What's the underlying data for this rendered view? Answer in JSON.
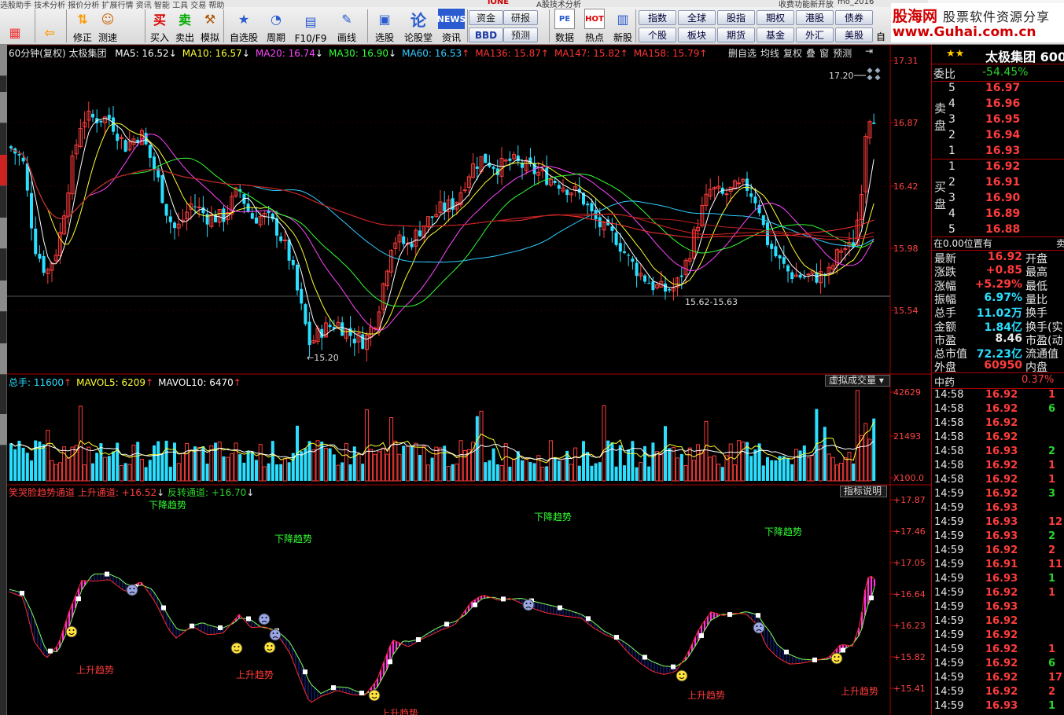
{
  "toolbar": {
    "menu_hint": "选股助手   技术分析   报价分析   扩展行情   资讯   智能   工具   交易   帮助",
    "buttons": [
      {
        "label": "",
        "icon": "grid-icon"
      },
      {
        "label": "",
        "icon": "back-arrow-icon"
      },
      {
        "label": "修正",
        "icon": "up-down-icon"
      },
      {
        "label": "测速",
        "icon": "smile-icon"
      },
      {
        "label": "买入",
        "icon": "buy-icon",
        "glyph": "买"
      },
      {
        "label": "卖出",
        "icon": "sell-icon",
        "glyph": "卖"
      },
      {
        "label": "模拟",
        "icon": "gavel-icon"
      },
      {
        "label": "自选股",
        "icon": "star-icon"
      },
      {
        "label": "周期",
        "icon": "clock-icon"
      },
      {
        "label": "F10/F9",
        "icon": "list-icon"
      },
      {
        "label": "画线",
        "icon": "pencil-icon"
      },
      {
        "label": "选股",
        "icon": "monitor-icon"
      },
      {
        "label": "论股堂",
        "icon": "lun-icon",
        "glyph": "论"
      },
      {
        "label": "资讯",
        "icon": "news-icon",
        "glyph": "NEWS"
      },
      {
        "label": "数据",
        "icon": "pe-icon",
        "glyph": "PE"
      },
      {
        "label": "热点",
        "icon": "hot-icon",
        "glyph": "HOT"
      },
      {
        "label": "新股",
        "icon": "new-stock-icon"
      }
    ],
    "small_buttons": [
      "资金",
      "研报",
      "BBD",
      "预测"
    ],
    "market_buttons": [
      "指数",
      "全球",
      "股指",
      "期权",
      "港股",
      "债券",
      "个股",
      "板块",
      "期货",
      "基金",
      "外汇",
      "美股"
    ],
    "extra": "自",
    "top_text": [
      "iONE",
      "A股技术分析",
      "收费功能新开放",
      "mo_2016"
    ]
  },
  "logo": {
    "line1": "股海网",
    "line2": "股票软件资源分享",
    "line3": "www.Guhai.com.cn"
  },
  "main_chart": {
    "title": "60分钟(复权)  太极集团",
    "ma": [
      {
        "label": "MA5: 16.52",
        "arrow": "↓",
        "color": "#ffffff"
      },
      {
        "label": "MA10: 16.57",
        "arrow": "↓",
        "color": "#ffff33"
      },
      {
        "label": "MA20: 16.74",
        "arrow": "↓",
        "color": "#ff44ff"
      },
      {
        "label": "MA30: 16.90",
        "arrow": "↓",
        "color": "#33ff33"
      },
      {
        "label": "MA60: 16.53",
        "arrow": "↑",
        "color": "#33ccff"
      },
      {
        "label": "MA136: 15.87",
        "arrow": "↑",
        "color": "#ff3333"
      },
      {
        "label": "MA147: 15.82",
        "arrow": "↑",
        "color": "#ff3333"
      },
      {
        "label": "MA158: 15.79",
        "arrow": "↑",
        "color": "#ff3333"
      }
    ],
    "controls": [
      "删自选",
      "均线",
      "复权",
      "叠",
      "窗",
      "预测"
    ],
    "y_axis": [
      "17.31",
      "16.87",
      "16.42",
      "15.98",
      "15.54"
    ],
    "annotations": {
      "high": "17.20",
      "low": "15.20",
      "range": "15.62-15.63"
    }
  },
  "volume": {
    "labels": [
      {
        "text": "总手: 11600",
        "color": "#2adfff"
      },
      {
        "text": "MAVOL5: 6209",
        "color": "#ffff33"
      },
      {
        "text": "MAVOL10: 6470",
        "color": "#ffffff"
      }
    ],
    "dropdown": "虚拟成交量",
    "y_axis": [
      "42629",
      "21493",
      "X100.0"
    ]
  },
  "indicator": {
    "name": "笑哭脸趋势通道",
    "up_channel": "上升通道: +16.52",
    "rev_channel": "反转通道: +16.70",
    "button": "指标说明",
    "y_axis": [
      "+17.87",
      "+17.46",
      "+17.05",
      "+16.64",
      "+16.23",
      "+15.82",
      "+15.41"
    ],
    "down_trend": [
      "下降趋势",
      "下降趋势",
      "下降趋势",
      "下降趋势"
    ],
    "up_trend": [
      "上升趋势",
      "上升趋势",
      "上升趋势",
      "上升趋势",
      "上升趋势"
    ]
  },
  "quote": {
    "stock_name": "太极集团 600",
    "weibi_label": "委比",
    "weibi": "-54.45%",
    "sell_label": "卖盘",
    "buy_label": "买盘",
    "sell": [
      {
        "n": "5",
        "p": "16.97"
      },
      {
        "n": "4",
        "p": "16.96"
      },
      {
        "n": "3",
        "p": "16.95"
      },
      {
        "n": "2",
        "p": "16.94"
      },
      {
        "n": "1",
        "p": "16.93"
      }
    ],
    "buy": [
      {
        "n": "1",
        "p": "16.92"
      },
      {
        "n": "2",
        "p": "16.91"
      },
      {
        "n": "3",
        "p": "16.90"
      },
      {
        "n": "4",
        "p": "16.89"
      },
      {
        "n": "5",
        "p": "16.88"
      }
    ],
    "position": "在0.00位置有",
    "position_right": "卖",
    "stats": [
      {
        "k": "最新",
        "v": "16.92",
        "c": "red",
        "k2": "开盘"
      },
      {
        "k": "涨跌",
        "v": "+0.85",
        "c": "red",
        "k2": "最高"
      },
      {
        "k": "涨幅",
        "v": "+5.29%",
        "c": "red",
        "k2": "最低"
      },
      {
        "k": "振幅",
        "v": "6.97%",
        "c": "cyan",
        "k2": "量比"
      },
      {
        "k": "总手",
        "v": "11.02万",
        "c": "cyan",
        "k2": "换手"
      },
      {
        "k": "金额",
        "v": "1.84亿",
        "c": "cyan",
        "k2": "换手(实"
      },
      {
        "k": "市盈",
        "v": "8.46",
        "c": "wht",
        "k2": "市盈(动"
      },
      {
        "k": "总市值",
        "v": "72.23亿",
        "c": "cyan",
        "k2": "流通值"
      },
      {
        "k": "外盘",
        "v": "60950",
        "c": "red",
        "k2": "内盘"
      }
    ],
    "sector": "中药",
    "sector_change": "0.37%",
    "ticks": [
      {
        "t": "14:58",
        "p": "16.92",
        "v": "1"
      },
      {
        "t": "14:58",
        "p": "16.92",
        "v": "6"
      },
      {
        "t": "14:58",
        "p": "16.92",
        "v": ""
      },
      {
        "t": "14:58",
        "p": "16.92",
        "v": ""
      },
      {
        "t": "14:58",
        "p": "16.93",
        "v": "2"
      },
      {
        "t": "14:58",
        "p": "16.92",
        "v": "1"
      },
      {
        "t": "14:58",
        "p": "16.92",
        "v": "1"
      },
      {
        "t": "14:59",
        "p": "16.92",
        "v": "3"
      },
      {
        "t": "14:59",
        "p": "16.93",
        "v": ""
      },
      {
        "t": "14:59",
        "p": "16.93",
        "v": "12"
      },
      {
        "t": "14:59",
        "p": "16.93",
        "v": "2"
      },
      {
        "t": "14:59",
        "p": "16.92",
        "v": "2"
      },
      {
        "t": "14:59",
        "p": "16.91",
        "v": "11"
      },
      {
        "t": "14:59",
        "p": "16.93",
        "v": "1"
      },
      {
        "t": "14:59",
        "p": "16.92",
        "v": "1"
      },
      {
        "t": "14:59",
        "p": "16.93",
        "v": ""
      },
      {
        "t": "14:59",
        "p": "16.92",
        "v": ""
      },
      {
        "t": "14:59",
        "p": "16.92",
        "v": ""
      },
      {
        "t": "14:59",
        "p": "16.92",
        "v": "1"
      },
      {
        "t": "14:59",
        "p": "16.92",
        "v": "6"
      },
      {
        "t": "14:59",
        "p": "16.92",
        "v": "17"
      },
      {
        "t": "14:59",
        "p": "16.92",
        "v": "2"
      },
      {
        "t": "14:59",
        "p": "16.93",
        "v": "1"
      }
    ]
  },
  "colors": {
    "up": "#ff3c3c",
    "down": "#2adfff",
    "pink": "#ff33dd",
    "navy": "#1a2aa8"
  }
}
